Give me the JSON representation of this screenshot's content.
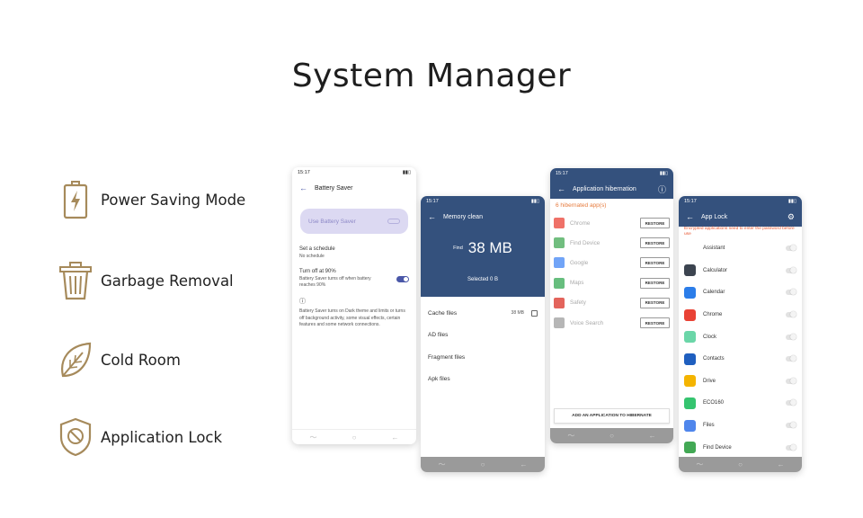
{
  "title": "System Manager",
  "features": [
    {
      "label": "Power Saving Mode",
      "icon": "battery-icon"
    },
    {
      "label": "Garbage Removal",
      "icon": "trash-icon"
    },
    {
      "label": "Cold Room",
      "icon": "leaf-icon"
    },
    {
      "label": "Application Lock",
      "icon": "shield-block-icon"
    }
  ],
  "colors": {
    "accent_gold": "#a68a5b",
    "header_blue": "#34517d",
    "warning_orange": "#e67a3c",
    "toggle_purple": "#4a57a8"
  },
  "phone1": {
    "time": "15:17",
    "title": "Battery Saver",
    "use_label": "Use Battery Saver",
    "schedule_title": "Set a schedule",
    "schedule_sub": "No schedule",
    "turnoff_title": "Turn off at 90%",
    "turnoff_sub": "Battery Saver turns off when battery reaches 90%",
    "info_text": "Battery Saver turns on Dark theme and limits or turns off background activity, some visual effects, certain features and some network connections."
  },
  "phone2": {
    "time": "15:17",
    "title": "Memory clean",
    "find_label": "Find",
    "size": "38 MB",
    "selected": "Selected 0 B",
    "items": [
      {
        "label": "Cache files",
        "size": "38 MB"
      },
      {
        "label": "AD files",
        "size": ""
      },
      {
        "label": "Fragment files",
        "size": ""
      },
      {
        "label": "Apk files",
        "size": ""
      }
    ]
  },
  "phone3": {
    "time": "15:17",
    "title": "Application hibernation",
    "count": "6 hibernated app(s)",
    "restore_label": "RESTORE",
    "apps": [
      "Chrome",
      "Find Device",
      "Google",
      "Maps",
      "Safety",
      "Voice Search"
    ],
    "add_button": "ADD AN APPLICATION TO HIBERNATE"
  },
  "phone4": {
    "time": "15:17",
    "title": "App Lock",
    "warning": "Encrypted applications need to enter the password before use",
    "apps": [
      {
        "name": "Assistant",
        "color": "#ffffff"
      },
      {
        "name": "Calculator",
        "color": "#3c4450"
      },
      {
        "name": "Calendar",
        "color": "#2b7de9"
      },
      {
        "name": "Chrome",
        "color": "#e94235"
      },
      {
        "name": "Clock",
        "color": "#6bd6a8"
      },
      {
        "name": "Contacts",
        "color": "#1f5fbf"
      },
      {
        "name": "Drive",
        "color": "#f4b400"
      },
      {
        "name": "ECO160",
        "color": "#35c46f"
      },
      {
        "name": "Files",
        "color": "#4f86ec"
      },
      {
        "name": "Find Device",
        "color": "#42a854"
      }
    ]
  }
}
